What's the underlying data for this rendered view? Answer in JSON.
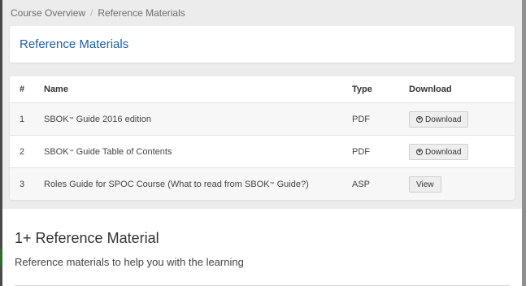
{
  "breadcrumb": {
    "items": [
      "Course Overview",
      "Reference Materials"
    ],
    "separator": "/"
  },
  "header": {
    "title": "Reference Materials"
  },
  "table": {
    "columns": [
      "#",
      "Name",
      "Type",
      "Download"
    ],
    "rows": [
      {
        "num": "1",
        "name": "SBOK",
        "name_tm": "™",
        "name_rest": " Guide 2016 edition",
        "type": "PDF",
        "action": "Download",
        "action_icon": "download-icon"
      },
      {
        "num": "2",
        "name": "SBOK",
        "name_tm": "™",
        "name_rest": " Guide Table of Contents",
        "type": "PDF",
        "action": "Download",
        "action_icon": "download-icon"
      },
      {
        "num": "3",
        "name": "Roles Guide for SPOC Course (What to read from SBOK",
        "name_tm": "™",
        "name_rest": " Guide?)",
        "type": "ASP",
        "action": "View"
      }
    ]
  },
  "section": {
    "heading": "1+ Reference Material",
    "description": "Reference materials to help you with the learning"
  },
  "colors": {
    "title": "#1e5ea8",
    "panel_bg": "#ececec"
  }
}
